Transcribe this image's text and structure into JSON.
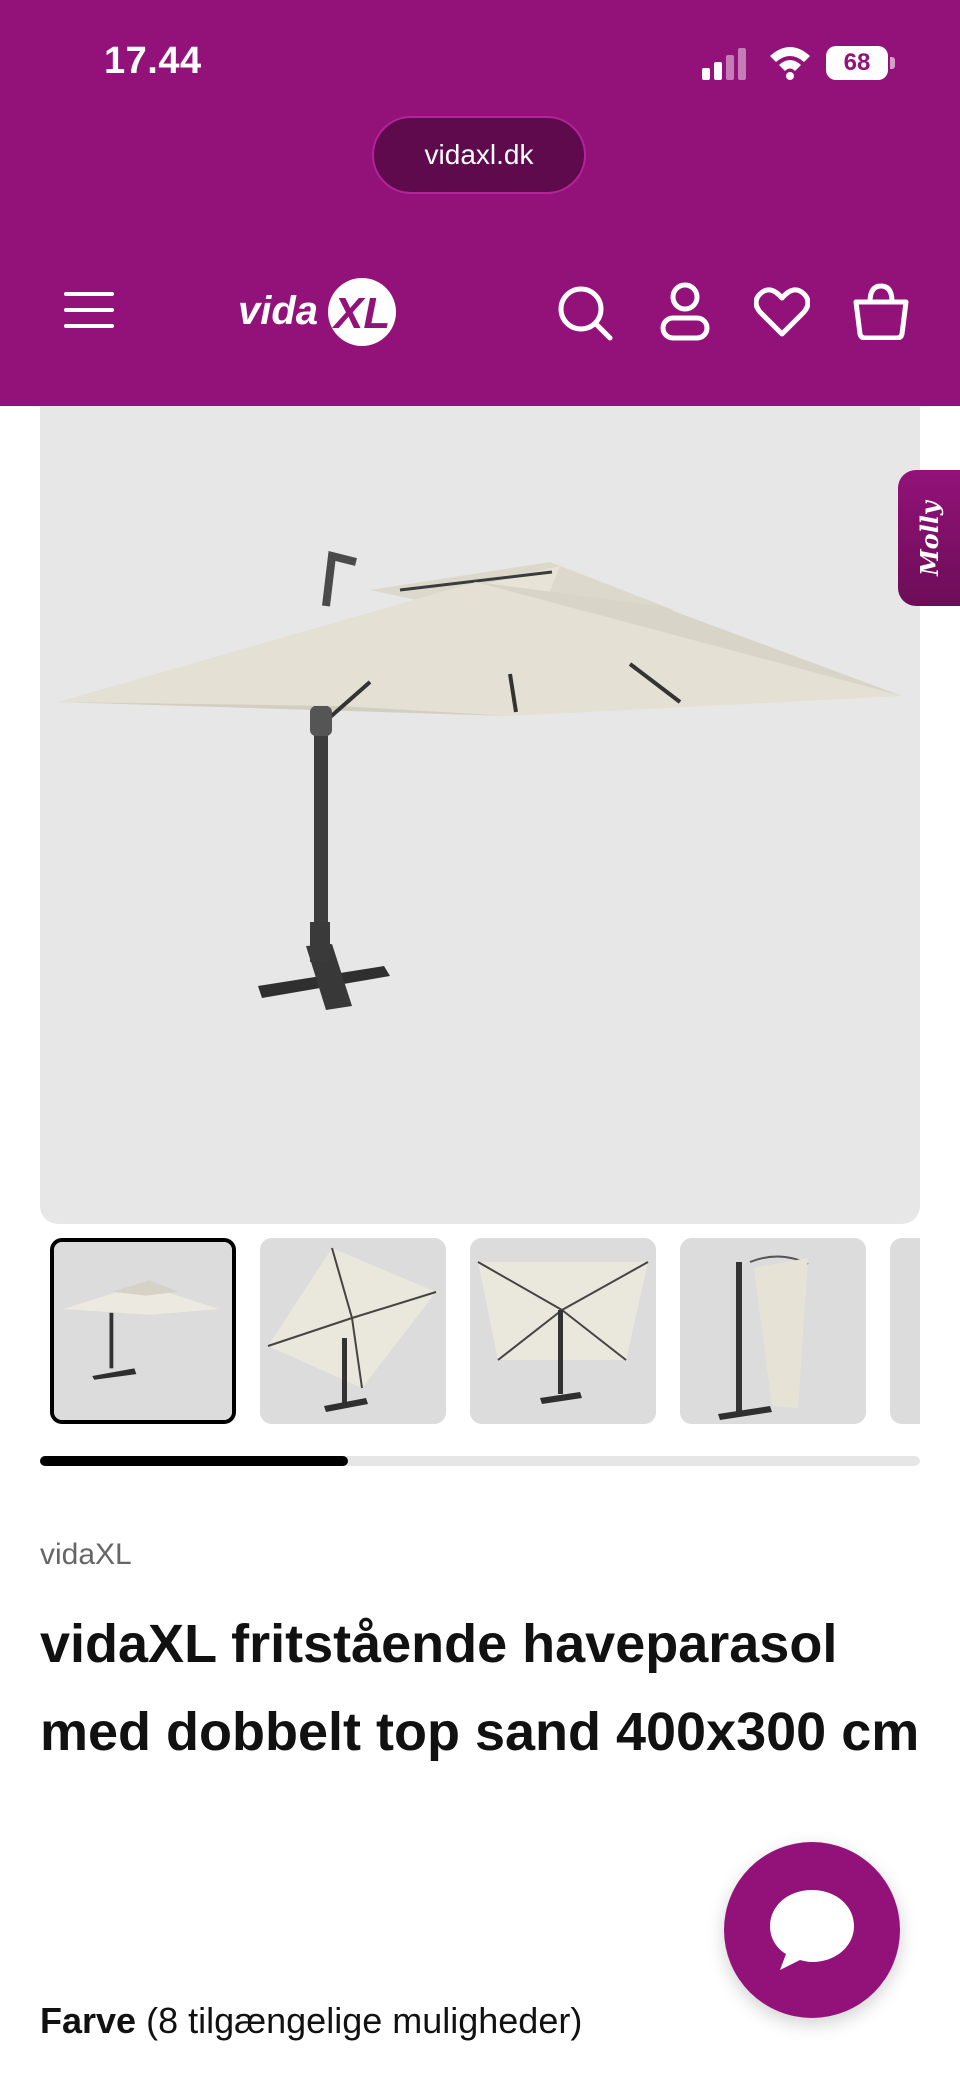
{
  "status_bar": {
    "time": "17.44",
    "battery": "68"
  },
  "browser": {
    "url": "vidaxl.dk"
  },
  "header": {
    "logo_text": "vidaXL",
    "background_color": "#931279",
    "icons": [
      "menu-icon",
      "search-icon",
      "account-icon",
      "wishlist-icon",
      "cart-icon"
    ]
  },
  "gallery": {
    "image_count_visible": 5,
    "active_index": 0,
    "scroll_progress": 0.35
  },
  "side_tab": {
    "label": "Molly"
  },
  "product": {
    "brand": "vidaXL",
    "title": "vidaXL fritstående haveparasol med dobbelt top sand 400x300 cm",
    "color_label": "Farve",
    "color_options_text": "(8 tilgængelige muligheder)"
  },
  "colors": {
    "brand_purple": "#931279",
    "image_background": "#e7e7e7"
  }
}
